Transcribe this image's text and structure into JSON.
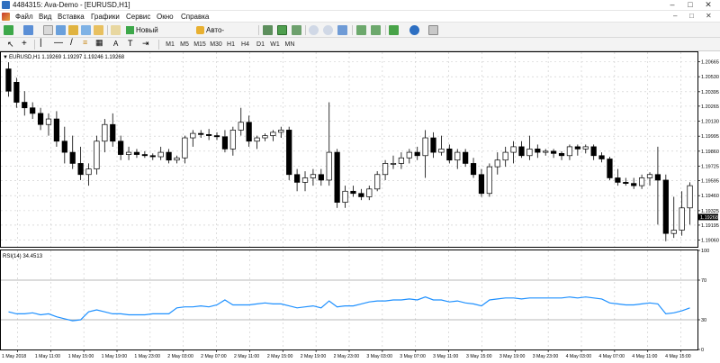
{
  "window": {
    "title": "4484315: Ava-Demo - [EURUSD,H1]",
    "controls": [
      "–",
      "□",
      "✕"
    ]
  },
  "menu": {
    "items": [
      "Файл",
      "Вид",
      "Вставка",
      "Графики",
      "Сервис",
      "Окно",
      "Справка"
    ],
    "window_controls": [
      "–",
      "□",
      "✕"
    ]
  },
  "toolbar": {
    "new_order_label": "Новый ордер",
    "autotrading_label": "Авто-торговля",
    "timeframes": [
      "M1",
      "M5",
      "M15",
      "M30",
      "H1",
      "H4",
      "D1",
      "W1",
      "MN"
    ]
  },
  "chart": {
    "header": "EURUSD,H1  1.19269 1.19297 1.19246 1.19268",
    "price_labels": [
      "1.20665",
      "1.20530",
      "1.20395",
      "1.20265",
      "1.20130",
      "1.19995",
      "1.19860",
      "1.19725",
      "1.19595",
      "1.19460",
      "1.19325",
      "1.19195",
      "1.19060"
    ],
    "current_price": "1.19268",
    "time_labels": [
      "1 May 2018",
      "1 May 11:00",
      "1 May 15:00",
      "1 May 19:00",
      "1 May 23:00",
      "2 May 03:00",
      "2 May 07:00",
      "2 May 11:00",
      "2 May 15:00",
      "2 May 19:00",
      "2 May 23:00",
      "3 May 03:00",
      "3 May 07:00",
      "3 May 11:00",
      "3 May 15:00",
      "3 May 19:00",
      "3 May 23:00",
      "4 May 03:00",
      "4 May 07:00",
      "4 May 11:00",
      "4 May 15:00"
    ],
    "colors": {
      "bull": "#ffffff",
      "bear": "#000000",
      "grid": "#c8c8c8",
      "rsi_line": "#1e90ff"
    }
  },
  "rsi": {
    "header": "RSI(14) 34.4513",
    "levels": [
      "100",
      "70",
      "30",
      "0"
    ]
  },
  "chart_data": {
    "type": "candlestick",
    "symbol": "EURUSD",
    "timeframe": "H1",
    "ylim": [
      1.19,
      1.2075
    ],
    "candles": [
      [
        1.206,
        1.2066,
        1.2035,
        1.204
      ],
      [
        1.2048,
        1.2052,
        1.2025,
        1.203
      ],
      [
        1.203,
        1.204,
        1.2018,
        1.2025
      ],
      [
        1.2025,
        1.203,
        1.2015,
        1.202
      ],
      [
        1.202,
        1.2025,
        1.2005,
        1.201
      ],
      [
        1.201,
        1.202,
        1.2,
        1.2015
      ],
      [
        1.2015,
        1.2022,
        1.199,
        1.1995
      ],
      [
        1.1995,
        1.2008,
        1.1975,
        1.1985
      ],
      [
        1.1985,
        1.2,
        1.197,
        1.1975
      ],
      [
        1.1975,
        1.199,
        1.196,
        1.1965
      ],
      [
        1.1965,
        1.1975,
        1.1955,
        1.197
      ],
      [
        1.197,
        1.2,
        1.1965,
        1.1995
      ],
      [
        1.1995,
        1.2015,
        1.1985,
        1.201
      ],
      [
        1.201,
        1.202,
        1.199,
        1.1995
      ],
      [
        1.1995,
        1.2,
        1.1978,
        1.1983
      ],
      [
        1.1983,
        1.199,
        1.1978,
        1.1985
      ],
      [
        1.1985,
        1.1988,
        1.198,
        1.1983
      ],
      [
        1.1983,
        1.1986,
        1.198,
        1.1982
      ],
      [
        1.1982,
        1.1984,
        1.1978,
        1.1981
      ],
      [
        1.1981,
        1.199,
        1.1978,
        1.1985
      ],
      [
        1.1985,
        1.1988,
        1.1975,
        1.1978
      ],
      [
        1.1978,
        1.1982,
        1.1975,
        1.198
      ],
      [
        1.198,
        1.2,
        1.1975,
        1.1998
      ],
      [
        1.1998,
        1.2005,
        1.199,
        1.2002
      ],
      [
        1.2002,
        1.2005,
        1.1998,
        1.2001
      ],
      [
        1.2001,
        1.2006,
        1.1996,
        1.2
      ],
      [
        1.2,
        1.2003,
        1.1996,
        1.1999
      ],
      [
        1.1999,
        1.2005,
        1.1985,
        1.1988
      ],
      [
        1.1988,
        1.2008,
        1.1982,
        1.2005
      ],
      [
        1.2005,
        1.2025,
        1.2,
        1.2012
      ],
      [
        1.2012,
        1.2018,
        1.199,
        1.1995
      ],
      [
        1.1995,
        1.2,
        1.1988,
        1.1998
      ],
      [
        1.1998,
        1.2002,
        1.1995,
        1.2
      ],
      [
        1.2,
        1.2005,
        1.1995,
        1.2003
      ],
      [
        1.2003,
        1.2008,
        1.1998,
        1.2005
      ],
      [
        1.2005,
        1.2008,
        1.196,
        1.1965
      ],
      [
        1.1965,
        1.197,
        1.195,
        1.1958
      ],
      [
        1.1958,
        1.1968,
        1.195,
        1.1962
      ],
      [
        1.1962,
        1.197,
        1.1955,
        1.1965
      ],
      [
        1.1965,
        1.197,
        1.1955,
        1.196
      ],
      [
        1.196,
        1.203,
        1.1955,
        1.1985
      ],
      [
        1.1985,
        1.1988,
        1.1935,
        1.194
      ],
      [
        1.194,
        1.1955,
        1.1935,
        1.195
      ],
      [
        1.195,
        1.1955,
        1.1945,
        1.1948
      ],
      [
        1.1948,
        1.1952,
        1.1942,
        1.1945
      ],
      [
        1.1945,
        1.1955,
        1.1942,
        1.1952
      ],
      [
        1.1952,
        1.1968,
        1.195,
        1.1965
      ],
      [
        1.1965,
        1.1978,
        1.196,
        1.1975
      ],
      [
        1.1975,
        1.1982,
        1.197,
        1.1975
      ],
      [
        1.1975,
        1.1985,
        1.197,
        1.198
      ],
      [
        1.198,
        1.1988,
        1.1975,
        1.1985
      ],
      [
        1.1985,
        1.199,
        1.1978,
        1.1982
      ],
      [
        1.1982,
        1.2005,
        1.1962,
        1.1998
      ],
      [
        1.1998,
        1.2003,
        1.198,
        1.1985
      ],
      [
        1.1985,
        1.2,
        1.1982,
        1.1988
      ],
      [
        1.1988,
        1.1992,
        1.1975,
        1.1978
      ],
      [
        1.1978,
        1.1988,
        1.197,
        1.1985
      ],
      [
        1.1985,
        1.1988,
        1.1972,
        1.1975
      ],
      [
        1.1975,
        1.198,
        1.1962,
        1.1965
      ],
      [
        1.1965,
        1.197,
        1.1945,
        1.1948
      ],
      [
        1.1948,
        1.1975,
        1.1945,
        1.1972
      ],
      [
        1.1972,
        1.1985,
        1.1965,
        1.1978
      ],
      [
        1.1978,
        1.199,
        1.1972,
        1.1985
      ],
      [
        1.1985,
        1.1995,
        1.1975,
        1.199
      ],
      [
        1.199,
        1.1995,
        1.198,
        1.1982
      ],
      [
        1.1982,
        1.2,
        1.1978,
        1.1988
      ],
      [
        1.1988,
        1.1992,
        1.198,
        1.1985
      ],
      [
        1.1985,
        1.1988,
        1.1982,
        1.1986
      ],
      [
        1.1986,
        1.1988,
        1.198,
        1.1984
      ],
      [
        1.1984,
        1.1986,
        1.1978,
        1.1982
      ],
      [
        1.1982,
        1.1992,
        1.1978,
        1.199
      ],
      [
        1.199,
        1.1992,
        1.1982,
        1.1988
      ],
      [
        1.1988,
        1.1992,
        1.1984,
        1.199
      ],
      [
        1.199,
        1.1992,
        1.1978,
        1.1982
      ],
      [
        1.1982,
        1.1985,
        1.1976,
        1.1979
      ],
      [
        1.1979,
        1.1981,
        1.196,
        1.1962
      ],
      [
        1.1962,
        1.197,
        1.1955,
        1.1958
      ],
      [
        1.1958,
        1.1962,
        1.1955,
        1.1957
      ],
      [
        1.1957,
        1.1962,
        1.1952,
        1.1955
      ],
      [
        1.1955,
        1.1965,
        1.1952,
        1.1962
      ],
      [
        1.1962,
        1.1967,
        1.1955,
        1.1965
      ],
      [
        1.1965,
        1.199,
        1.192,
        1.196
      ],
      [
        1.196,
        1.1965,
        1.1905,
        1.1912
      ],
      [
        1.1912,
        1.1945,
        1.1908,
        1.1915
      ],
      [
        1.1915,
        1.195,
        1.191,
        1.1935
      ],
      [
        1.1935,
        1.1958,
        1.192,
        1.1955
      ]
    ],
    "rsi": [
      38,
      36,
      36,
      37,
      35,
      36,
      33,
      31,
      29,
      30,
      38,
      40,
      38,
      36,
      36,
      35,
      35,
      35,
      36,
      36,
      36,
      42,
      43,
      43,
      44,
      43,
      45,
      50,
      45,
      45,
      45,
      46,
      47,
      46,
      46,
      44,
      42,
      43,
      44,
      42,
      49,
      43,
      44,
      44,
      46,
      48,
      49,
      49,
      50,
      50,
      51,
      50,
      53,
      50,
      50,
      48,
      49,
      47,
      46,
      44,
      50,
      51,
      52,
      52,
      51,
      52,
      52,
      52,
      52,
      52,
      53,
      52,
      53,
      52,
      51,
      47,
      46,
      45,
      45,
      46,
      47,
      46,
      36,
      37,
      39,
      42
    ],
    "rsi_levels": [
      30,
      70
    ],
    "rsi_ylim": [
      0,
      100
    ]
  }
}
